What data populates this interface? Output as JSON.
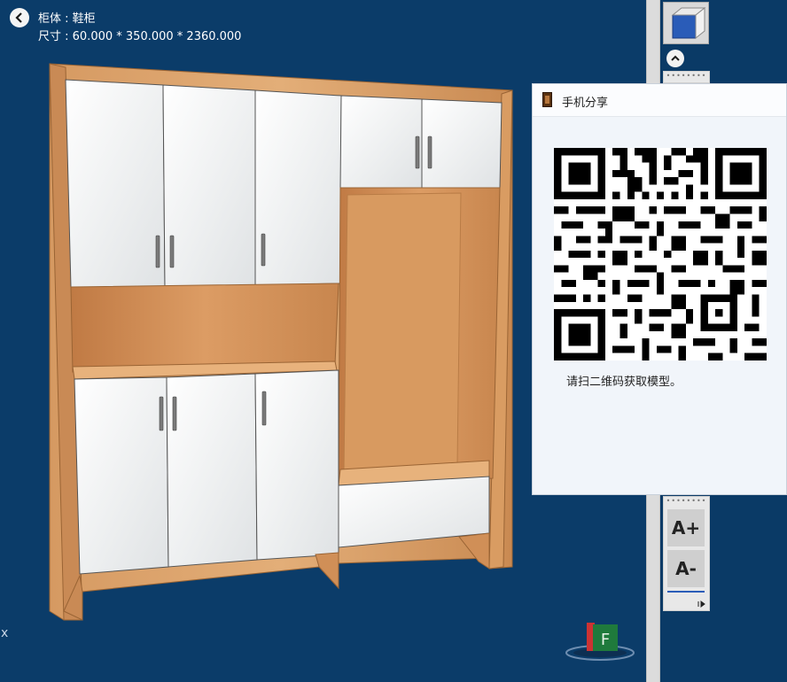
{
  "viewport": {
    "cabinet_label": "柜体 : 鞋柜",
    "size_label": "尺寸 : 60.000 * 350.000 * 2360.000",
    "axis_label": "x"
  },
  "share": {
    "title": "手机分享",
    "caption": "请扫二维码获取模型。"
  },
  "tools": {
    "font_increase": "A+",
    "font_decrease": "A-",
    "dots": "••••••••"
  },
  "logo": {
    "letter": "F"
  }
}
